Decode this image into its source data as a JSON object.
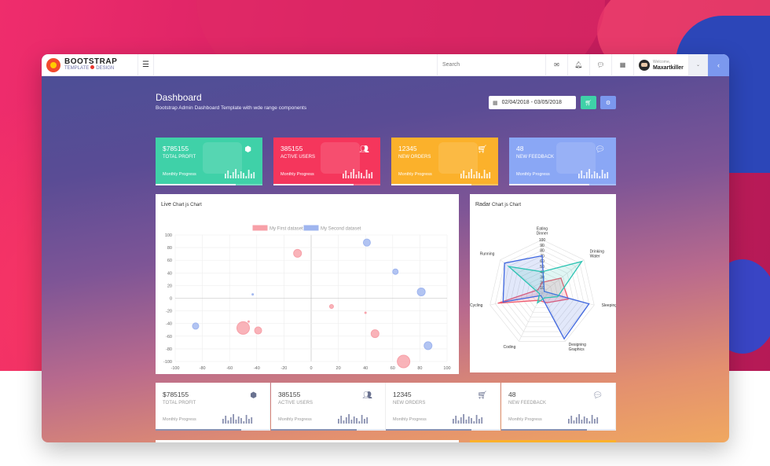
{
  "brand": {
    "name": "BOOTSTRAP",
    "sub_left": "TEMPLATE",
    "sub_right": "DESIGN"
  },
  "topbar": {
    "menu_icon": "hamburger-icon",
    "search_placeholder": "Search",
    "icons": [
      "envelope-icon",
      "bell-icon",
      "chat-icon",
      "grid-icon"
    ],
    "welcome": "Welcome,",
    "username": "Maxartkiller",
    "caret": "⌄",
    "collapse": "‹"
  },
  "header": {
    "title": "Dashboard",
    "subtitle": "Bootstrap Admin Dashboard Template with wde range components",
    "daterange": "02/04/2018 - 03/05/2018",
    "cart_button_icon": "cart-icon",
    "share_button_icon": "share-icon"
  },
  "stat_cards": [
    {
      "value": "$785155",
      "label": "TOTAL PROFIT",
      "progress_label": "Monthly Progress",
      "icon": "cubes-icon",
      "color": "#3fd1a8",
      "progress": 0.75
    },
    {
      "value": "385155",
      "label": "ACTIVE USERS",
      "progress_label": "Monthly Progress",
      "icon": "users-icon",
      "color": "#f5365c",
      "progress": 0.75
    },
    {
      "value": "12345",
      "label": "NEW ORDERS",
      "progress_label": "Monthly Progress",
      "icon": "cart-icon",
      "color": "#fbb12b",
      "progress": 0.75
    },
    {
      "value": "48",
      "label": "NEW FEEDBACK",
      "progress_label": "Monthly Progress",
      "icon": "comments-icon",
      "color": "#8aa7f5",
      "progress": 0.75
    }
  ],
  "white_cards": [
    {
      "value": "$785155",
      "label": "TOTAL PROFIT",
      "progress_label": "Monthly Progress",
      "icon": "cubes-icon",
      "progress": 0.75
    },
    {
      "value": "385155",
      "label": "ACTIVE USERS",
      "progress_label": "Monthly Progress",
      "icon": "users-icon",
      "progress": 0.75
    },
    {
      "value": "12345",
      "label": "NEW ORDERS",
      "progress_label": "Monthly Progress",
      "icon": "cart-icon",
      "progress": 0.75
    },
    {
      "value": "48",
      "label": "NEW FEEDBACK",
      "progress_label": "Monthly Progress",
      "icon": "comments-icon",
      "progress": 0.75
    }
  ],
  "live_chart": {
    "title_main": "Live",
    "title_rest": "Chart js Chart"
  },
  "radar_chart": {
    "title_main": "Radar",
    "title_rest": "Chart js Chart"
  },
  "chart_data": [
    {
      "type": "scatter",
      "title": "Live Chart js Chart",
      "xlim": [
        -100,
        100
      ],
      "ylim": [
        -100,
        100
      ],
      "xticks": [
        -100,
        -80,
        -60,
        -40,
        -20,
        0,
        20,
        40,
        60,
        80,
        100
      ],
      "yticks": [
        100,
        80,
        60,
        40,
        20,
        0,
        -20,
        -40,
        -60,
        -80,
        -100
      ],
      "grid": true,
      "legend_position": "top",
      "series": [
        {
          "name": "My First dataset",
          "color": "#f7a0a8",
          "points": [
            {
              "x": -10,
              "y": 71,
              "r": 5
            },
            {
              "x": -50,
              "y": -47,
              "r": 8
            },
            {
              "x": -39,
              "y": -51,
              "r": 4.5
            },
            {
              "x": 15,
              "y": -13,
              "r": 2.5
            },
            {
              "x": 47,
              "y": -56,
              "r": 5
            },
            {
              "x": 68,
              "y": -100,
              "r": 8
            },
            {
              "x": 40,
              "y": -23,
              "r": 1
            },
            {
              "x": -46,
              "y": -37,
              "r": 1
            }
          ]
        },
        {
          "name": "My Second dataset",
          "color": "#9fb5ef",
          "points": [
            {
              "x": 41,
              "y": 88,
              "r": 4.5
            },
            {
              "x": 62,
              "y": 42,
              "r": 3.5
            },
            {
              "x": 81,
              "y": 10,
              "r": 5
            },
            {
              "x": -85,
              "y": -44,
              "r": 4
            },
            {
              "x": 86,
              "y": -75,
              "r": 5
            },
            {
              "x": -43,
              "y": 6,
              "r": 1
            }
          ]
        }
      ]
    },
    {
      "type": "radar",
      "title": "Radar Chart js Chart",
      "labels": [
        [
          "Eating",
          "Dinner"
        ],
        [
          "Drinking",
          "Water"
        ],
        [
          "Sleeping"
        ],
        [
          "Designing",
          "Graphics"
        ],
        [
          "Coding"
        ],
        [
          "Cycling"
        ],
        [
          "Running"
        ]
      ],
      "rlim": [
        0,
        100
      ],
      "ticks": [
        0,
        10,
        20,
        30,
        40,
        50,
        60,
        70,
        80,
        90,
        100
      ],
      "series": [
        {
          "color": "#f05a6e",
          "fill": "rgba(240,90,110,0.18)",
          "values": [
            20,
            45,
            50,
            20,
            15,
            85,
            10
          ]
        },
        {
          "color": "#3f67e0",
          "fill": "rgba(63,103,224,0.15)",
          "values": [
            70,
            5,
            90,
            95,
            5,
            75,
            90
          ]
        },
        {
          "color": "#2cc4b3",
          "fill": "rgba(44,196,179,0.15)",
          "values": [
            40,
            95,
            30,
            10,
            20,
            5,
            80
          ]
        }
      ]
    }
  ]
}
